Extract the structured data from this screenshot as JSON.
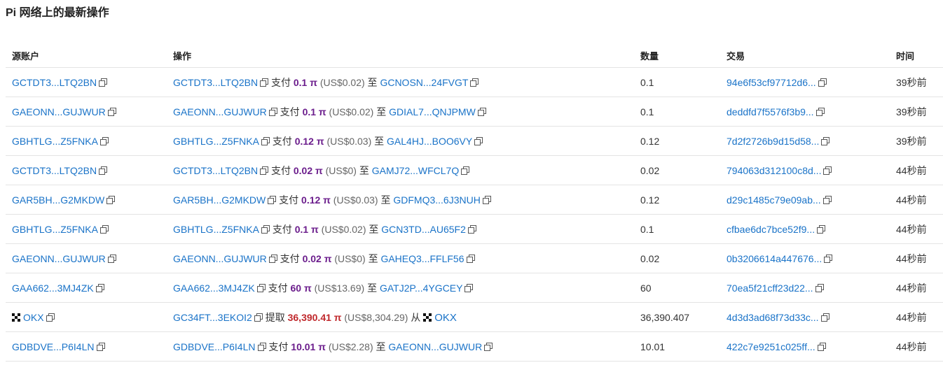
{
  "page_title": "Pi 网络上的最新操作",
  "columns": {
    "source": "源账户",
    "operation": "操作",
    "amount": "数量",
    "transaction": "交易",
    "time": "时间"
  },
  "rows": [
    {
      "source": "GCTDT3...LTQ2BN",
      "op_from": "GCTDT3...LTQ2BN",
      "op_verb": "支付",
      "op_amount": "0.1 π",
      "op_usd": "(US$0.02)",
      "op_dir": "至",
      "op_to": "GCNOSN...24FVGT",
      "amount": "0.1",
      "tx": "94e6f53cf97712d6...",
      "time": "39秒前"
    },
    {
      "source": "GAEONN...GUJWUR",
      "op_from": "GAEONN...GUJWUR",
      "op_verb": "支付",
      "op_amount": "0.1 π",
      "op_usd": "(US$0.02)",
      "op_dir": "至",
      "op_to": "GDIAL7...QNJPMW",
      "amount": "0.1",
      "tx": "deddfd7f5576f3b9...",
      "time": "39秒前"
    },
    {
      "source": "GBHTLG...Z5FNKA",
      "op_from": "GBHTLG...Z5FNKA",
      "op_verb": "支付",
      "op_amount": "0.12 π",
      "op_usd": "(US$0.03)",
      "op_dir": "至",
      "op_to": "GAL4HJ...BOO6VY",
      "amount": "0.12",
      "tx": "7d2f2726b9d15d58...",
      "time": "39秒前"
    },
    {
      "source": "GCTDT3...LTQ2BN",
      "op_from": "GCTDT3...LTQ2BN",
      "op_verb": "支付",
      "op_amount": "0.02 π",
      "op_usd": "(US$0)",
      "op_dir": "至",
      "op_to": "GAMJ72...WFCL7Q",
      "amount": "0.02",
      "tx": "794063d312100c8d...",
      "time": "44秒前"
    },
    {
      "source": "GAR5BH...G2MKDW",
      "op_from": "GAR5BH...G2MKDW",
      "op_verb": "支付",
      "op_amount": "0.12 π",
      "op_usd": "(US$0.03)",
      "op_dir": "至",
      "op_to": "GDFMQ3...6J3NUH",
      "amount": "0.12",
      "tx": "d29c1485c79e09ab...",
      "time": "44秒前"
    },
    {
      "source": "GBHTLG...Z5FNKA",
      "op_from": "GBHTLG...Z5FNKA",
      "op_verb": "支付",
      "op_amount": "0.1 π",
      "op_usd": "(US$0.02)",
      "op_dir": "至",
      "op_to": "GCN3TD...AU65F2",
      "amount": "0.1",
      "tx": "cfbae6dc7bce52f9...",
      "time": "44秒前"
    },
    {
      "source": "GAEONN...GUJWUR",
      "op_from": "GAEONN...GUJWUR",
      "op_verb": "支付",
      "op_amount": "0.02 π",
      "op_usd": "(US$0)",
      "op_dir": "至",
      "op_to": "GAHEQ3...FFLF56",
      "amount": "0.02",
      "tx": "0b3206614a447676...",
      "time": "44秒前"
    },
    {
      "source": "GAA662...3MJ4ZK",
      "op_from": "GAA662...3MJ4ZK",
      "op_verb": "支付",
      "op_amount": "60 π",
      "op_usd": "(US$13.69)",
      "op_dir": "至",
      "op_to": "GATJ2P...4YGCEY",
      "amount": "60",
      "tx": "70ea5f21cff23d22...",
      "time": "44秒前"
    },
    {
      "source": "OKX",
      "op_from": "GC34FT...3EKOI2",
      "op_verb": "提取",
      "op_amount": "36,390.41 π",
      "op_usd": "(US$8,304.29)",
      "op_dir": "从",
      "op_to": "OKX",
      "amount": "36,390.407",
      "tx": "4d3d3ad68f73d33c...",
      "time": "44秒前"
    },
    {
      "source": "GDBDVE...P6I4LN",
      "op_from": "GDBDVE...P6I4LN",
      "op_verb": "支付",
      "op_amount": "10.01 π",
      "op_usd": "(US$2.28)",
      "op_dir": "至",
      "op_to": "GAEONN...GUJWUR",
      "amount": "10.01",
      "tx": "422c7e9251c025ff...",
      "time": "44秒前"
    }
  ],
  "colors": {
    "link": "#1a73c8",
    "amount_payment": "#6b1d8c",
    "amount_withdraw": "#c0282c"
  }
}
